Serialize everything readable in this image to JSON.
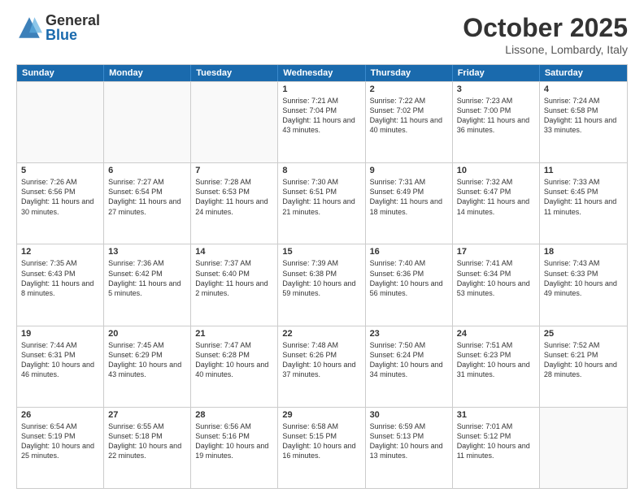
{
  "logo": {
    "general": "General",
    "blue": "Blue"
  },
  "title": "October 2025",
  "subtitle": "Lissone, Lombardy, Italy",
  "days": [
    "Sunday",
    "Monday",
    "Tuesday",
    "Wednesday",
    "Thursday",
    "Friday",
    "Saturday"
  ],
  "weeks": [
    [
      {
        "num": "",
        "text": ""
      },
      {
        "num": "",
        "text": ""
      },
      {
        "num": "",
        "text": ""
      },
      {
        "num": "1",
        "text": "Sunrise: 7:21 AM\nSunset: 7:04 PM\nDaylight: 11 hours and 43 minutes."
      },
      {
        "num": "2",
        "text": "Sunrise: 7:22 AM\nSunset: 7:02 PM\nDaylight: 11 hours and 40 minutes."
      },
      {
        "num": "3",
        "text": "Sunrise: 7:23 AM\nSunset: 7:00 PM\nDaylight: 11 hours and 36 minutes."
      },
      {
        "num": "4",
        "text": "Sunrise: 7:24 AM\nSunset: 6:58 PM\nDaylight: 11 hours and 33 minutes."
      }
    ],
    [
      {
        "num": "5",
        "text": "Sunrise: 7:26 AM\nSunset: 6:56 PM\nDaylight: 11 hours and 30 minutes."
      },
      {
        "num": "6",
        "text": "Sunrise: 7:27 AM\nSunset: 6:54 PM\nDaylight: 11 hours and 27 minutes."
      },
      {
        "num": "7",
        "text": "Sunrise: 7:28 AM\nSunset: 6:53 PM\nDaylight: 11 hours and 24 minutes."
      },
      {
        "num": "8",
        "text": "Sunrise: 7:30 AM\nSunset: 6:51 PM\nDaylight: 11 hours and 21 minutes."
      },
      {
        "num": "9",
        "text": "Sunrise: 7:31 AM\nSunset: 6:49 PM\nDaylight: 11 hours and 18 minutes."
      },
      {
        "num": "10",
        "text": "Sunrise: 7:32 AM\nSunset: 6:47 PM\nDaylight: 11 hours and 14 minutes."
      },
      {
        "num": "11",
        "text": "Sunrise: 7:33 AM\nSunset: 6:45 PM\nDaylight: 11 hours and 11 minutes."
      }
    ],
    [
      {
        "num": "12",
        "text": "Sunrise: 7:35 AM\nSunset: 6:43 PM\nDaylight: 11 hours and 8 minutes."
      },
      {
        "num": "13",
        "text": "Sunrise: 7:36 AM\nSunset: 6:42 PM\nDaylight: 11 hours and 5 minutes."
      },
      {
        "num": "14",
        "text": "Sunrise: 7:37 AM\nSunset: 6:40 PM\nDaylight: 11 hours and 2 minutes."
      },
      {
        "num": "15",
        "text": "Sunrise: 7:39 AM\nSunset: 6:38 PM\nDaylight: 10 hours and 59 minutes."
      },
      {
        "num": "16",
        "text": "Sunrise: 7:40 AM\nSunset: 6:36 PM\nDaylight: 10 hours and 56 minutes."
      },
      {
        "num": "17",
        "text": "Sunrise: 7:41 AM\nSunset: 6:34 PM\nDaylight: 10 hours and 53 minutes."
      },
      {
        "num": "18",
        "text": "Sunrise: 7:43 AM\nSunset: 6:33 PM\nDaylight: 10 hours and 49 minutes."
      }
    ],
    [
      {
        "num": "19",
        "text": "Sunrise: 7:44 AM\nSunset: 6:31 PM\nDaylight: 10 hours and 46 minutes."
      },
      {
        "num": "20",
        "text": "Sunrise: 7:45 AM\nSunset: 6:29 PM\nDaylight: 10 hours and 43 minutes."
      },
      {
        "num": "21",
        "text": "Sunrise: 7:47 AM\nSunset: 6:28 PM\nDaylight: 10 hours and 40 minutes."
      },
      {
        "num": "22",
        "text": "Sunrise: 7:48 AM\nSunset: 6:26 PM\nDaylight: 10 hours and 37 minutes."
      },
      {
        "num": "23",
        "text": "Sunrise: 7:50 AM\nSunset: 6:24 PM\nDaylight: 10 hours and 34 minutes."
      },
      {
        "num": "24",
        "text": "Sunrise: 7:51 AM\nSunset: 6:23 PM\nDaylight: 10 hours and 31 minutes."
      },
      {
        "num": "25",
        "text": "Sunrise: 7:52 AM\nSunset: 6:21 PM\nDaylight: 10 hours and 28 minutes."
      }
    ],
    [
      {
        "num": "26",
        "text": "Sunrise: 6:54 AM\nSunset: 5:19 PM\nDaylight: 10 hours and 25 minutes."
      },
      {
        "num": "27",
        "text": "Sunrise: 6:55 AM\nSunset: 5:18 PM\nDaylight: 10 hours and 22 minutes."
      },
      {
        "num": "28",
        "text": "Sunrise: 6:56 AM\nSunset: 5:16 PM\nDaylight: 10 hours and 19 minutes."
      },
      {
        "num": "29",
        "text": "Sunrise: 6:58 AM\nSunset: 5:15 PM\nDaylight: 10 hours and 16 minutes."
      },
      {
        "num": "30",
        "text": "Sunrise: 6:59 AM\nSunset: 5:13 PM\nDaylight: 10 hours and 13 minutes."
      },
      {
        "num": "31",
        "text": "Sunrise: 7:01 AM\nSunset: 5:12 PM\nDaylight: 10 hours and 11 minutes."
      },
      {
        "num": "",
        "text": ""
      }
    ]
  ]
}
